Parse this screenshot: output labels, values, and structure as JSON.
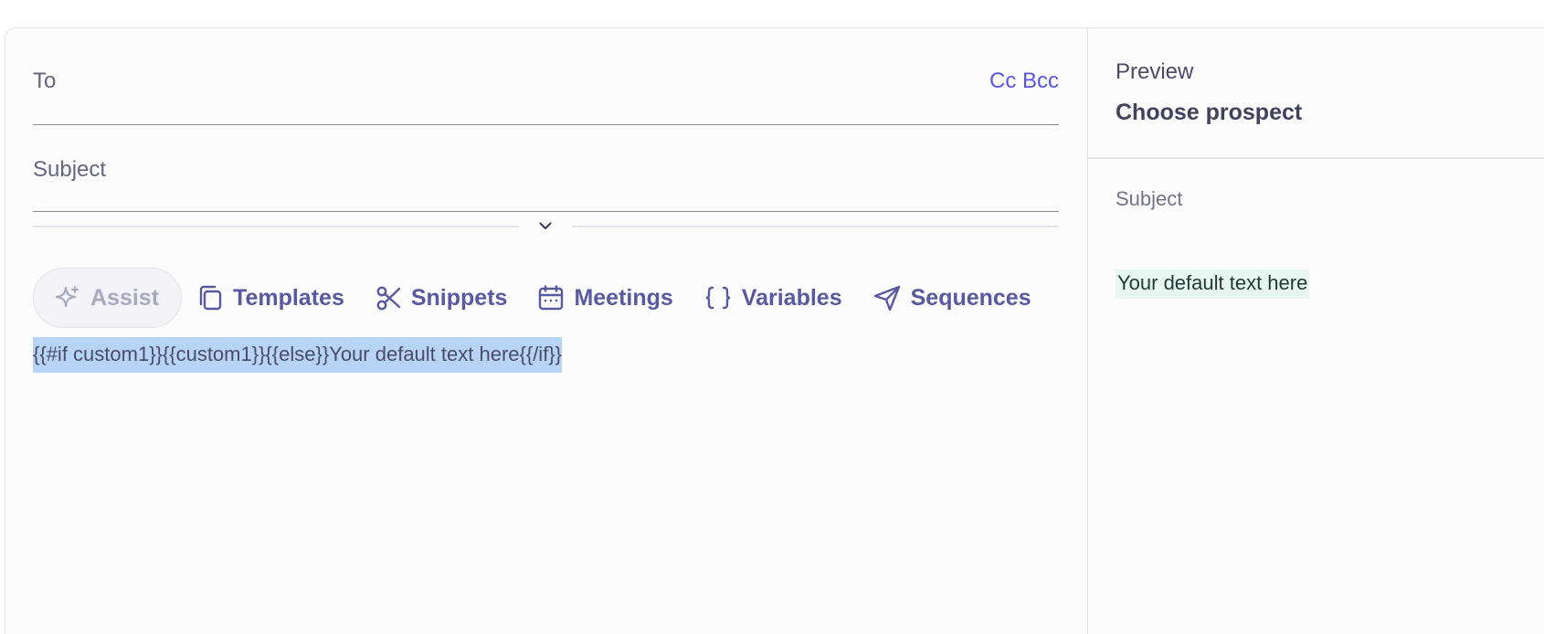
{
  "composer": {
    "to_label": "To",
    "cc_bcc_label": "Cc Bcc",
    "subject_label": "Subject"
  },
  "toolbar": {
    "assist": {
      "label": "Assist",
      "icon": "sparkle-icon"
    },
    "templates": {
      "label": "Templates",
      "icon": "copy-icon"
    },
    "snippets": {
      "label": "Snippets",
      "icon": "scissors-icon"
    },
    "meetings": {
      "label": "Meetings",
      "icon": "calendar-icon"
    },
    "variables": {
      "label": "Variables",
      "icon": "braces-icon"
    },
    "sequences": {
      "label": "Sequences",
      "icon": "send-icon"
    }
  },
  "editor": {
    "body_text": "{{#if custom1}}{{custom1}}{{else}}Your default text here{{/if}}"
  },
  "preview": {
    "title": "Preview",
    "choose_prospect": "Choose prospect",
    "subject_label": "Subject",
    "body_text": "Your default text here"
  },
  "colors": {
    "accent": "#585aa0",
    "link": "#5a55e0",
    "selection": "#b7d4f7",
    "preview_highlight": "#e8f6f1"
  }
}
